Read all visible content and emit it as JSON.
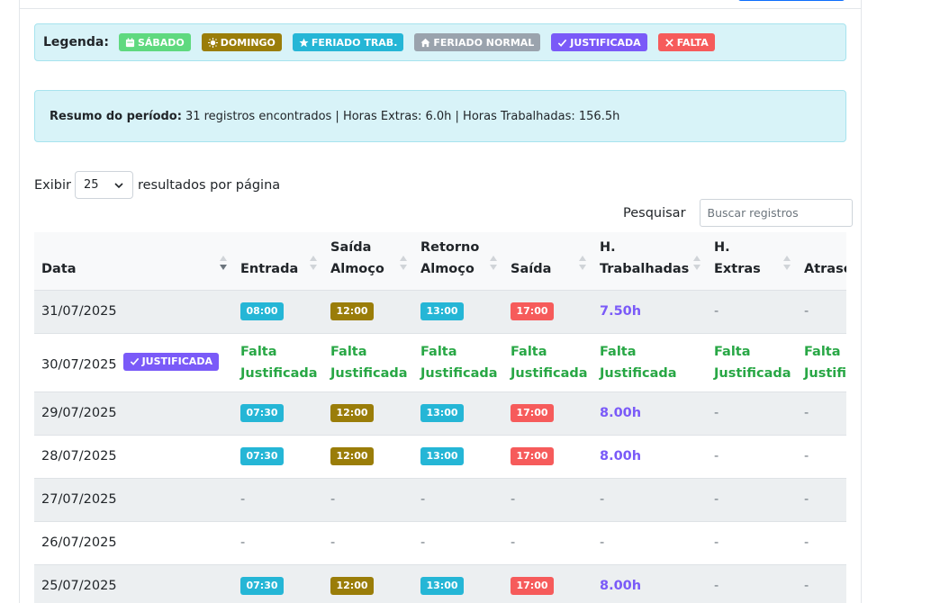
{
  "legend": {
    "title": "Legenda:",
    "items": [
      {
        "label": "SÁBADO",
        "icon": "calendar-icon",
        "color": "#5fd97f"
      },
      {
        "label": "DOMINGO",
        "icon": "sun-icon",
        "color": "#9a7d09"
      },
      {
        "label": "FERIADO TRAB.",
        "icon": "star-icon",
        "color": "#25b6d6"
      },
      {
        "label": "FERIADO NORMAL",
        "icon": "home-icon",
        "color": "#9aa3ad"
      },
      {
        "label": "JUSTIFICADA",
        "icon": "check-icon",
        "color": "#7a5af8"
      },
      {
        "label": "FALTA",
        "icon": "x-icon",
        "color": "#f65b5b"
      }
    ]
  },
  "summary": {
    "label": "Resumo do período:",
    "text": "31 registros encontrados | Horas Extras: 6.0h | Horas Trabalhadas: 156.5h"
  },
  "length": {
    "prefix": "Exibir",
    "value": "25",
    "suffix": "resultados por página"
  },
  "search": {
    "label": "Pesquisar",
    "placeholder": "Buscar registros"
  },
  "table": {
    "headers": {
      "data": "Data",
      "entrada": "Entrada",
      "saida_almoco_1": "Saída",
      "saida_almoco_2": "Almoço",
      "retorno_1": "Retorno",
      "retorno_2": "Almoço",
      "saida": "Saída",
      "htrab_1": "H.",
      "htrab_2": "Trabalhadas",
      "hext_1": "H.",
      "hext_2": "Extras",
      "atraso": "Atraso"
    },
    "justified_badge": "JUSTIFICADA",
    "falta_1": "Falta",
    "falta_2": "Justificada",
    "dash": "-",
    "rows": [
      {
        "date": "31/07/2025",
        "entrada": "08:00",
        "saida_almoco": "12:00",
        "retorno": "13:00",
        "saida": "17:00",
        "horas": "7.50h",
        "extras": "-",
        "atraso": "-"
      },
      {
        "date": "30/07/2025"
      },
      {
        "date": "29/07/2025",
        "entrada": "07:30",
        "saida_almoco": "12:00",
        "retorno": "13:00",
        "saida": "17:00",
        "horas": "8.00h",
        "extras": "-",
        "atraso": "-"
      },
      {
        "date": "28/07/2025",
        "entrada": "07:30",
        "saida_almoco": "12:00",
        "retorno": "13:00",
        "saida": "17:00",
        "horas": "8.00h",
        "extras": "-",
        "atraso": "-"
      },
      {
        "date": "27/07/2025",
        "entrada": "-",
        "saida_almoco": "-",
        "retorno": "-",
        "saida": "-",
        "horas": "-",
        "extras": "-",
        "atraso": "-"
      },
      {
        "date": "26/07/2025",
        "entrada": "-",
        "saida_almoco": "-",
        "retorno": "-",
        "saida": "-",
        "horas": "-",
        "extras": "-",
        "atraso": "-"
      },
      {
        "date": "25/07/2025",
        "entrada": "07:30",
        "saida_almoco": "12:00",
        "retorno": "13:00",
        "saida": "17:00",
        "horas": "8.00h",
        "extras": "-",
        "atraso": "-"
      }
    ]
  }
}
